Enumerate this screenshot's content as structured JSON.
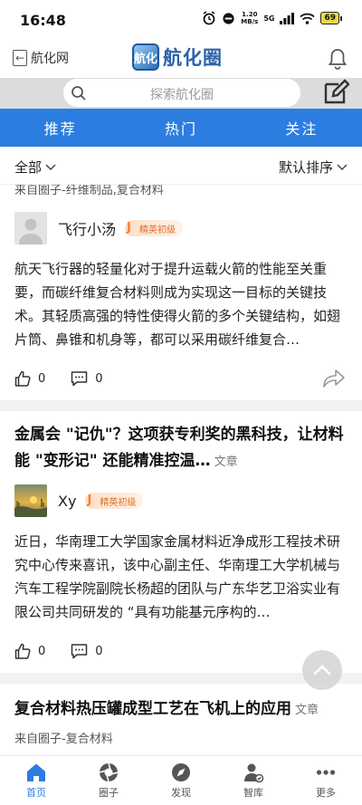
{
  "status_bar": {
    "time": "16:48",
    "net_speed_value": "1.20",
    "net_speed_unit": "MB/s",
    "network": "5G",
    "battery": "69"
  },
  "header": {
    "back_label": "航化网",
    "logo_text": "航化圈",
    "logo_mark": "航化"
  },
  "search": {
    "placeholder": "探索航化圈"
  },
  "tabs": [
    {
      "label": "推荐",
      "active": true
    },
    {
      "label": "热门",
      "active": false
    },
    {
      "label": "关注",
      "active": false
    }
  ],
  "filter": {
    "category": "全部",
    "sort": "默认排序"
  },
  "posts": [
    {
      "source": "来自圈子-纤维制品,复合材料",
      "author": "飞行小汤",
      "badge": "精英初级",
      "body": "航天飞行器的轻量化对于提升运载火箭的性能至关重要，而碳纤维复合材料则成为实现这一目标的关键技术。其轻质高强的特性使得火箭的多个关键结构，如翅片筒、鼻锥和机身等，都可以采用碳纤维复合…",
      "likes": "0",
      "comments": "0"
    },
    {
      "title": "金属会 \"记仇\"？这项获专利奖的黑科技，让材料能 \"变形记\" 还能精准控温…",
      "kind": "文章",
      "author": "Xy",
      "badge": "精英初级",
      "body": "近日，华南理工大学国家金属材料近净成形工程技术研究中心传来喜讯，该中心副主任、华南理工大学机械与汽车工程学院副院长杨超的团队与广东华艺卫浴实业有限公司共同研发的 “具有功能基元序构的…",
      "likes": "0",
      "comments": "0"
    },
    {
      "title": "复合材料热压罐成型工艺在飞机上的应用",
      "kind": "文章",
      "source": "来自圈子-复合材料"
    }
  ],
  "bottom_nav": [
    {
      "label": "首页",
      "icon": "home-icon",
      "active": true
    },
    {
      "label": "圈子",
      "icon": "aperture-icon",
      "active": false
    },
    {
      "label": "发现",
      "icon": "compass-icon",
      "active": false
    },
    {
      "label": "智库",
      "icon": "expert-icon",
      "active": false
    },
    {
      "label": "更多",
      "icon": "more-icon",
      "active": false
    }
  ],
  "colors": {
    "accent": "#2b7de0",
    "badge_text": "#e07030"
  }
}
